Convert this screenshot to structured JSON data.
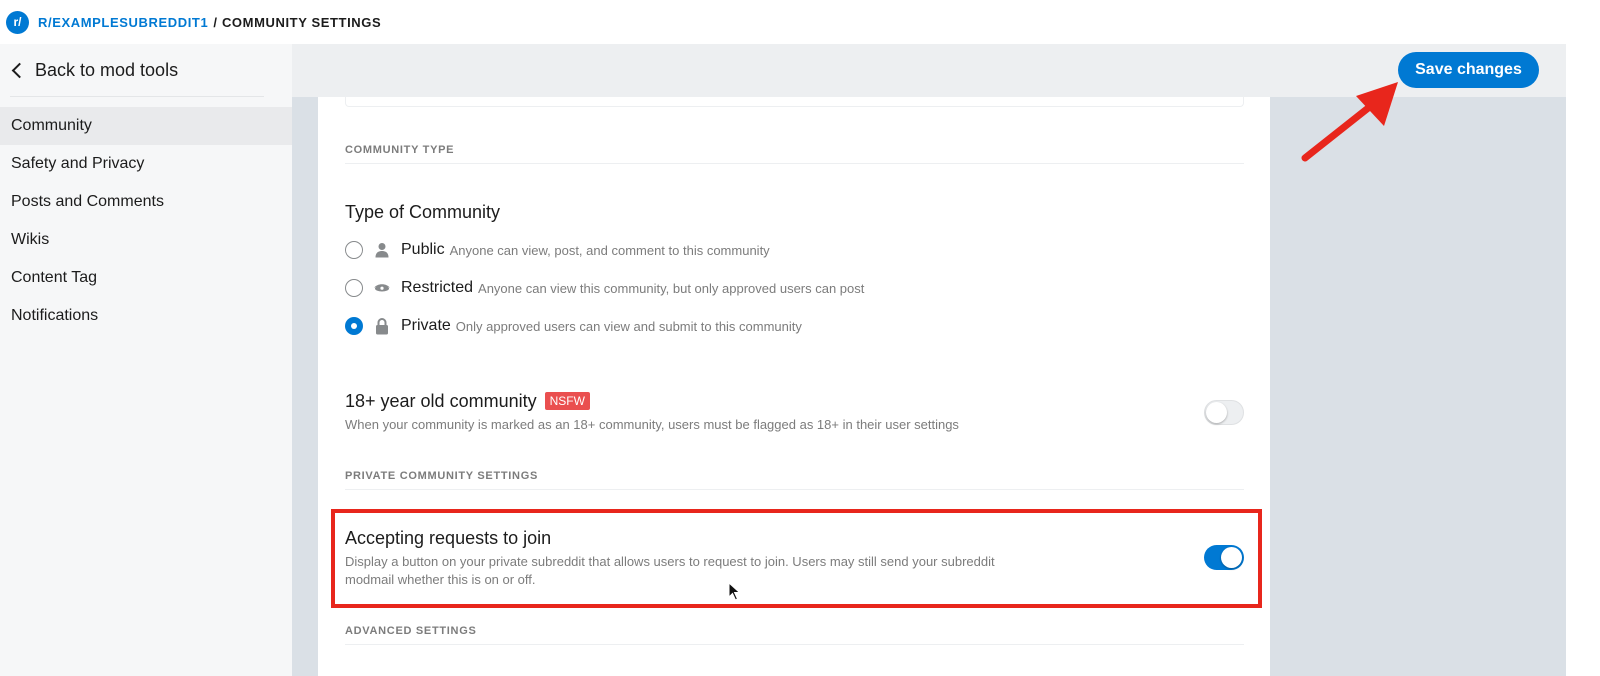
{
  "topbar": {
    "logo_text": "r/",
    "subreddit": "R/EXAMPLESUBREDDIT1",
    "separator": "/",
    "page": "COMMUNITY SETTINGS"
  },
  "sidebar": {
    "back_label": "Back to mod tools",
    "items": [
      {
        "label": "Community",
        "active": true
      },
      {
        "label": "Safety and Privacy"
      },
      {
        "label": "Posts and Comments"
      },
      {
        "label": "Wikis"
      },
      {
        "label": "Content Tag"
      },
      {
        "label": "Notifications"
      }
    ]
  },
  "header": {
    "save_label": "Save changes"
  },
  "community_type": {
    "section_title": "COMMUNITY TYPE",
    "heading": "Type of Community",
    "options": [
      {
        "label": "Public",
        "description": "Anyone can view, post, and comment to this community",
        "icon": "person-icon",
        "checked": false
      },
      {
        "label": "Restricted",
        "description": "Anyone can view this community, but only approved users can post",
        "icon": "eye-icon",
        "checked": false
      },
      {
        "label": "Private",
        "description": "Only approved users can view and submit to this community",
        "icon": "lock-icon",
        "checked": true
      }
    ]
  },
  "nsfw": {
    "heading": "18+ year old community",
    "badge": "NSFW",
    "description": "When your community is marked as an 18+ community, users must be flagged as 18+ in their user settings",
    "enabled": false
  },
  "private_settings": {
    "section_title": "PRIVATE COMMUNITY SETTINGS",
    "heading": "Accepting requests to join",
    "description_line1": "Display a button on your private subreddit that allows users to request to join. Users may still send your subreddit",
    "description_line2": "modmail whether this is on or off.",
    "enabled": true
  },
  "advanced": {
    "section_title": "ADVANCED SETTINGS"
  },
  "colors": {
    "accent": "#0079d3",
    "nsfw": "#ea4f4f",
    "annotation": "#e8261c"
  }
}
